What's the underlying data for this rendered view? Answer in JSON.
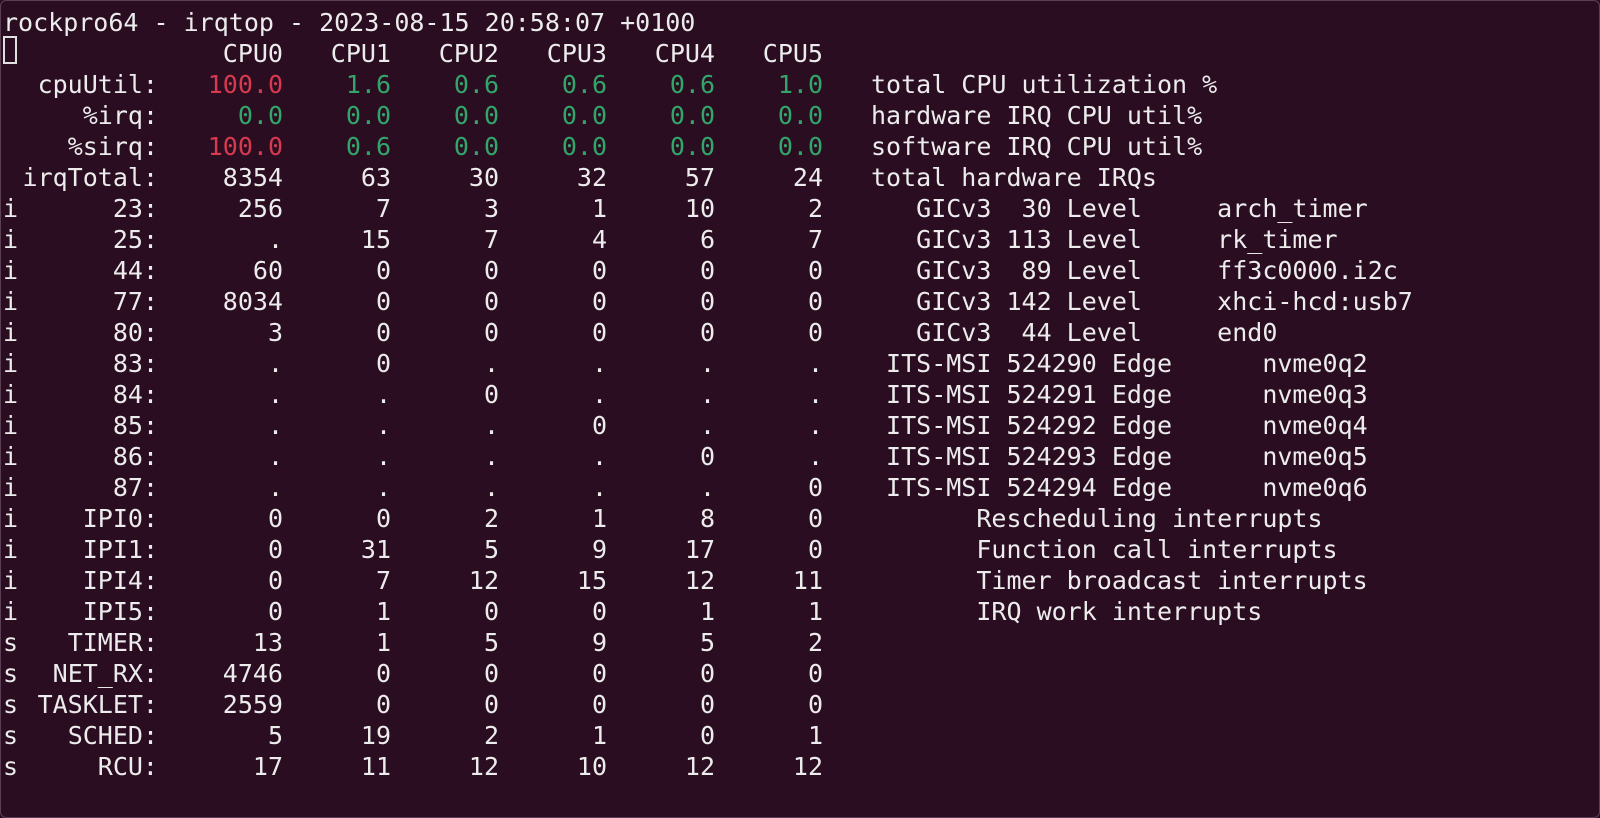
{
  "title_line": "rockpro64 - irqtop - 2023-08-15 20:58:07 +0100",
  "cpu_headers": [
    "CPU0",
    "CPU1",
    "CPU2",
    "CPU3",
    "CPU4",
    "CPU5"
  ],
  "colors": {
    "red": "#d63a4e",
    "green": "#32a66a",
    "text": "#ececec",
    "background": "#2b0d22"
  },
  "stat_rows": [
    {
      "type": "",
      "label": "cpuUtil:",
      "values": [
        "100.0",
        "1.6",
        "0.6",
        "0.6",
        "0.6",
        "1.0"
      ],
      "colors": [
        "red",
        "green",
        "green",
        "green",
        "green",
        "green"
      ],
      "desc": "total CPU utilization %"
    },
    {
      "type": "",
      "label": "%irq:",
      "values": [
        "0.0",
        "0.0",
        "0.0",
        "0.0",
        "0.0",
        "0.0"
      ],
      "colors": [
        "green",
        "green",
        "green",
        "green",
        "green",
        "green"
      ],
      "desc": "hardware IRQ CPU util%"
    },
    {
      "type": "",
      "label": "%sirq:",
      "values": [
        "100.0",
        "0.6",
        "0.0",
        "0.0",
        "0.0",
        "0.0"
      ],
      "colors": [
        "red",
        "green",
        "green",
        "green",
        "green",
        "green"
      ],
      "desc": "software IRQ CPU util%"
    },
    {
      "type": "",
      "label": "irqTotal:",
      "values": [
        "8354",
        "63",
        "30",
        "32",
        "57",
        "24"
      ],
      "colors": [
        "",
        "",
        "",
        "",
        "",
        ""
      ],
      "desc": "total hardware IRQs"
    }
  ],
  "irq_rows": [
    {
      "type": "i",
      "label": "23:",
      "values": [
        "256",
        "7",
        "3",
        "1",
        "10",
        "2"
      ],
      "desc": "   GICv3  30 Level     arch_timer"
    },
    {
      "type": "i",
      "label": "25:",
      "values": [
        ".",
        "15",
        "7",
        "4",
        "6",
        "7"
      ],
      "desc": "   GICv3 113 Level     rk_timer"
    },
    {
      "type": "i",
      "label": "44:",
      "values": [
        "60",
        "0",
        "0",
        "0",
        "0",
        "0"
      ],
      "desc": "   GICv3  89 Level     ff3c0000.i2c"
    },
    {
      "type": "i",
      "label": "77:",
      "values": [
        "8034",
        "0",
        "0",
        "0",
        "0",
        "0"
      ],
      "desc": "   GICv3 142 Level     xhci-hcd:usb7"
    },
    {
      "type": "i",
      "label": "80:",
      "values": [
        "3",
        "0",
        "0",
        "0",
        "0",
        "0"
      ],
      "desc": "   GICv3  44 Level     end0"
    },
    {
      "type": "i",
      "label": "83:",
      "values": [
        ".",
        "0",
        ".",
        ".",
        ".",
        "."
      ],
      "desc": " ITS-MSI 524290 Edge      nvme0q2"
    },
    {
      "type": "i",
      "label": "84:",
      "values": [
        ".",
        ".",
        "0",
        ".",
        ".",
        "."
      ],
      "desc": " ITS-MSI 524291 Edge      nvme0q3"
    },
    {
      "type": "i",
      "label": "85:",
      "values": [
        ".",
        ".",
        ".",
        "0",
        ".",
        "."
      ],
      "desc": " ITS-MSI 524292 Edge      nvme0q4"
    },
    {
      "type": "i",
      "label": "86:",
      "values": [
        ".",
        ".",
        ".",
        ".",
        "0",
        "."
      ],
      "desc": " ITS-MSI 524293 Edge      nvme0q5"
    },
    {
      "type": "i",
      "label": "87:",
      "values": [
        ".",
        ".",
        ".",
        ".",
        ".",
        "0"
      ],
      "desc": " ITS-MSI 524294 Edge      nvme0q6"
    },
    {
      "type": "i",
      "label": "IPI0:",
      "values": [
        "0",
        "0",
        "2",
        "1",
        "8",
        "0"
      ],
      "desc": "       Rescheduling interrupts"
    },
    {
      "type": "i",
      "label": "IPI1:",
      "values": [
        "0",
        "31",
        "5",
        "9",
        "17",
        "0"
      ],
      "desc": "       Function call interrupts"
    },
    {
      "type": "i",
      "label": "IPI4:",
      "values": [
        "0",
        "7",
        "12",
        "15",
        "12",
        "11"
      ],
      "desc": "       Timer broadcast interrupts"
    },
    {
      "type": "i",
      "label": "IPI5:",
      "values": [
        "0",
        "1",
        "0",
        "0",
        "1",
        "1"
      ],
      "desc": "       IRQ work interrupts"
    },
    {
      "type": "s",
      "label": "TIMER:",
      "values": [
        "13",
        "1",
        "5",
        "9",
        "5",
        "2"
      ],
      "desc": ""
    },
    {
      "type": "s",
      "label": "NET_RX:",
      "values": [
        "4746",
        "0",
        "0",
        "0",
        "0",
        "0"
      ],
      "desc": ""
    },
    {
      "type": "s",
      "label": "TASKLET:",
      "values": [
        "2559",
        "0",
        "0",
        "0",
        "0",
        "0"
      ],
      "desc": ""
    },
    {
      "type": "s",
      "label": "SCHED:",
      "values": [
        "5",
        "19",
        "2",
        "1",
        "0",
        "1"
      ],
      "desc": ""
    },
    {
      "type": "s",
      "label": "RCU:",
      "values": [
        "17",
        "11",
        "12",
        "10",
        "12",
        "12"
      ],
      "desc": ""
    }
  ]
}
